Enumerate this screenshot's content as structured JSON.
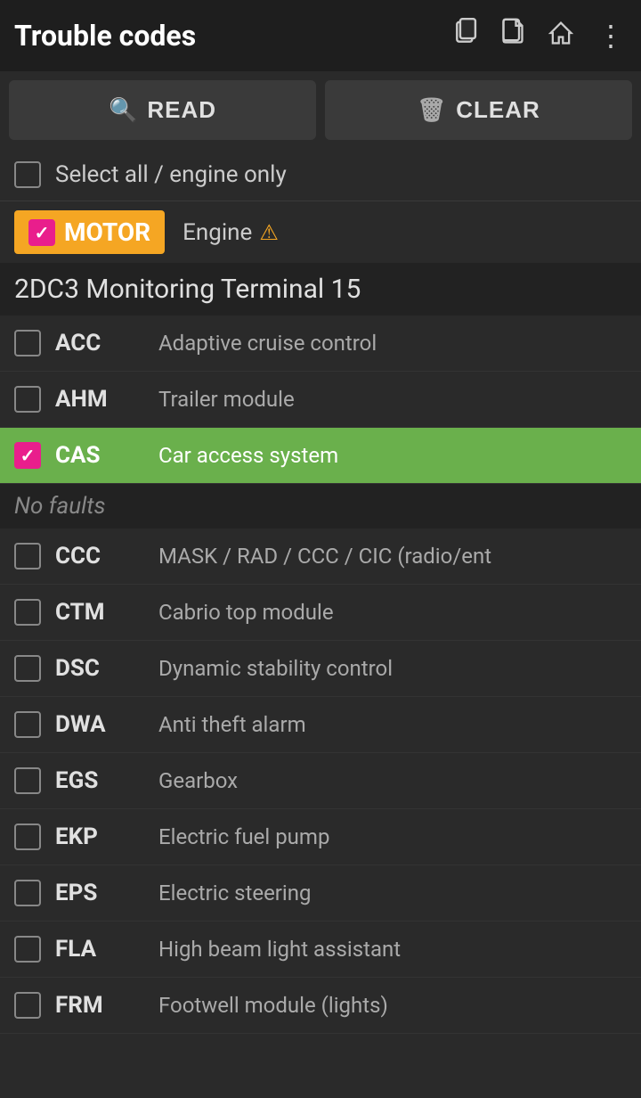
{
  "header": {
    "title": "Trouble codes",
    "icons": [
      "copy-icon",
      "document-icon",
      "home-icon",
      "more-icon"
    ]
  },
  "toolbar": {
    "read_label": "READ",
    "clear_label": "CLEAR",
    "read_icon": "🔍",
    "clear_icon": "🗑"
  },
  "select_all": {
    "label": "Select all / engine only",
    "checked": false
  },
  "motor": {
    "badge": "MOTOR",
    "label": "Engine",
    "checked": true,
    "warning": "⚠"
  },
  "section_heading": "2DC3 Monitoring Terminal 15",
  "no_faults": "No faults",
  "items": [
    {
      "code": "ACC",
      "desc": "Adaptive cruise control",
      "checked": false,
      "highlighted": false
    },
    {
      "code": "AHM",
      "desc": "Trailer module",
      "checked": false,
      "highlighted": false
    },
    {
      "code": "CAS",
      "desc": "Car access system",
      "checked": true,
      "highlighted": true
    },
    {
      "code": "CCC",
      "desc": "MASK / RAD / CCC / CIC (radio/ent",
      "checked": false,
      "highlighted": false
    },
    {
      "code": "CTM",
      "desc": "Cabrio top module",
      "checked": false,
      "highlighted": false
    },
    {
      "code": "DSC",
      "desc": "Dynamic stability control",
      "checked": false,
      "highlighted": false
    },
    {
      "code": "DWA",
      "desc": "Anti theft alarm",
      "checked": false,
      "highlighted": false
    },
    {
      "code": "EGS",
      "desc": "Gearbox",
      "checked": false,
      "highlighted": false
    },
    {
      "code": "EKP",
      "desc": "Electric fuel pump",
      "checked": false,
      "highlighted": false
    },
    {
      "code": "EPS",
      "desc": "Electric steering",
      "checked": false,
      "highlighted": false
    },
    {
      "code": "FLA",
      "desc": "High beam light assistant",
      "checked": false,
      "highlighted": false
    },
    {
      "code": "FRM",
      "desc": "Footwell module (lights)",
      "checked": false,
      "highlighted": false
    }
  ]
}
